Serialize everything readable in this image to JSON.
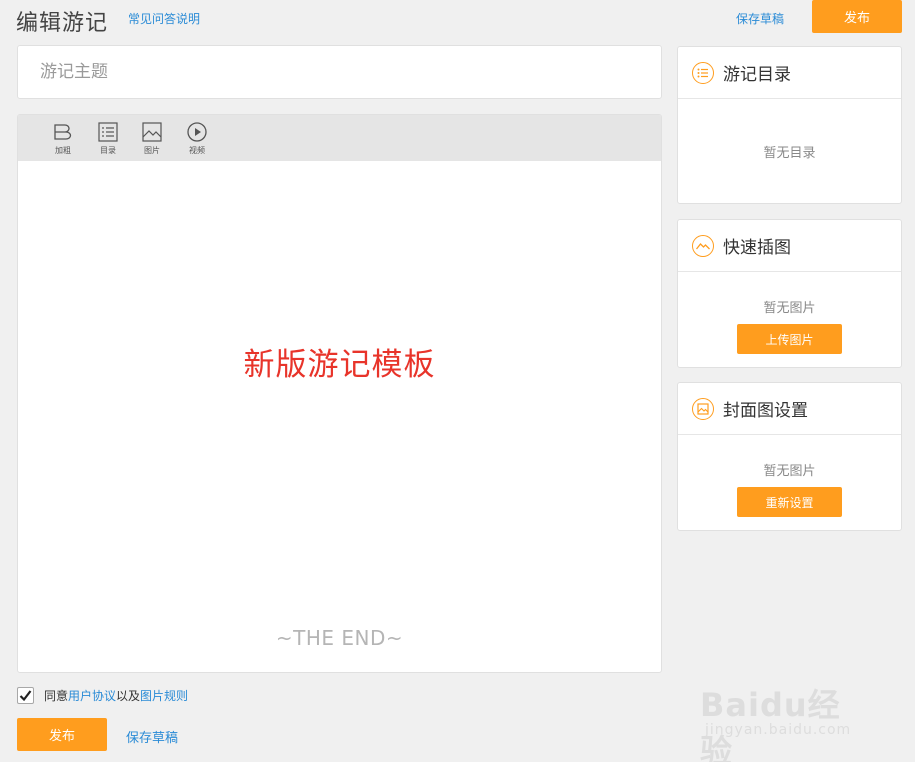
{
  "header": {
    "title": "编辑游记",
    "faq_link": "常见问答说明",
    "save_draft": "保存草稿",
    "publish": "发布"
  },
  "title_input": {
    "placeholder": "游记主题",
    "value": ""
  },
  "toolbar": {
    "items": [
      {
        "label": "加粗",
        "icon": "bold-icon"
      },
      {
        "label": "目录",
        "icon": "list-icon"
      },
      {
        "label": "图片",
        "icon": "image-icon"
      },
      {
        "label": "视频",
        "icon": "video-icon"
      }
    ]
  },
  "editor": {
    "template_title": "新版游记模板",
    "end_text": "~THE END~"
  },
  "agreement": {
    "checked": true,
    "prefix": "同意",
    "user_agreement": "用户协议",
    "middle": "以及",
    "image_rules": "图片规则"
  },
  "footer": {
    "publish": "发布",
    "save_draft": "保存草稿"
  },
  "panels": {
    "toc": {
      "title": "游记目录",
      "empty": "暂无目录",
      "icon": "list-circle-icon"
    },
    "quick_image": {
      "title": "快速插图",
      "empty": "暂无图片",
      "button": "上传图片",
      "icon": "mountain-circle-icon"
    },
    "cover": {
      "title": "封面图设置",
      "empty": "暂无图片",
      "button": "重新设置",
      "icon": "picture-circle-icon"
    }
  },
  "watermark": {
    "brand": "Baidu经验",
    "sub": "jingyan.baidu.com"
  },
  "colors": {
    "accent": "#ff9d1e",
    "link": "#2a8bd6",
    "template_title": "#e8342a"
  }
}
